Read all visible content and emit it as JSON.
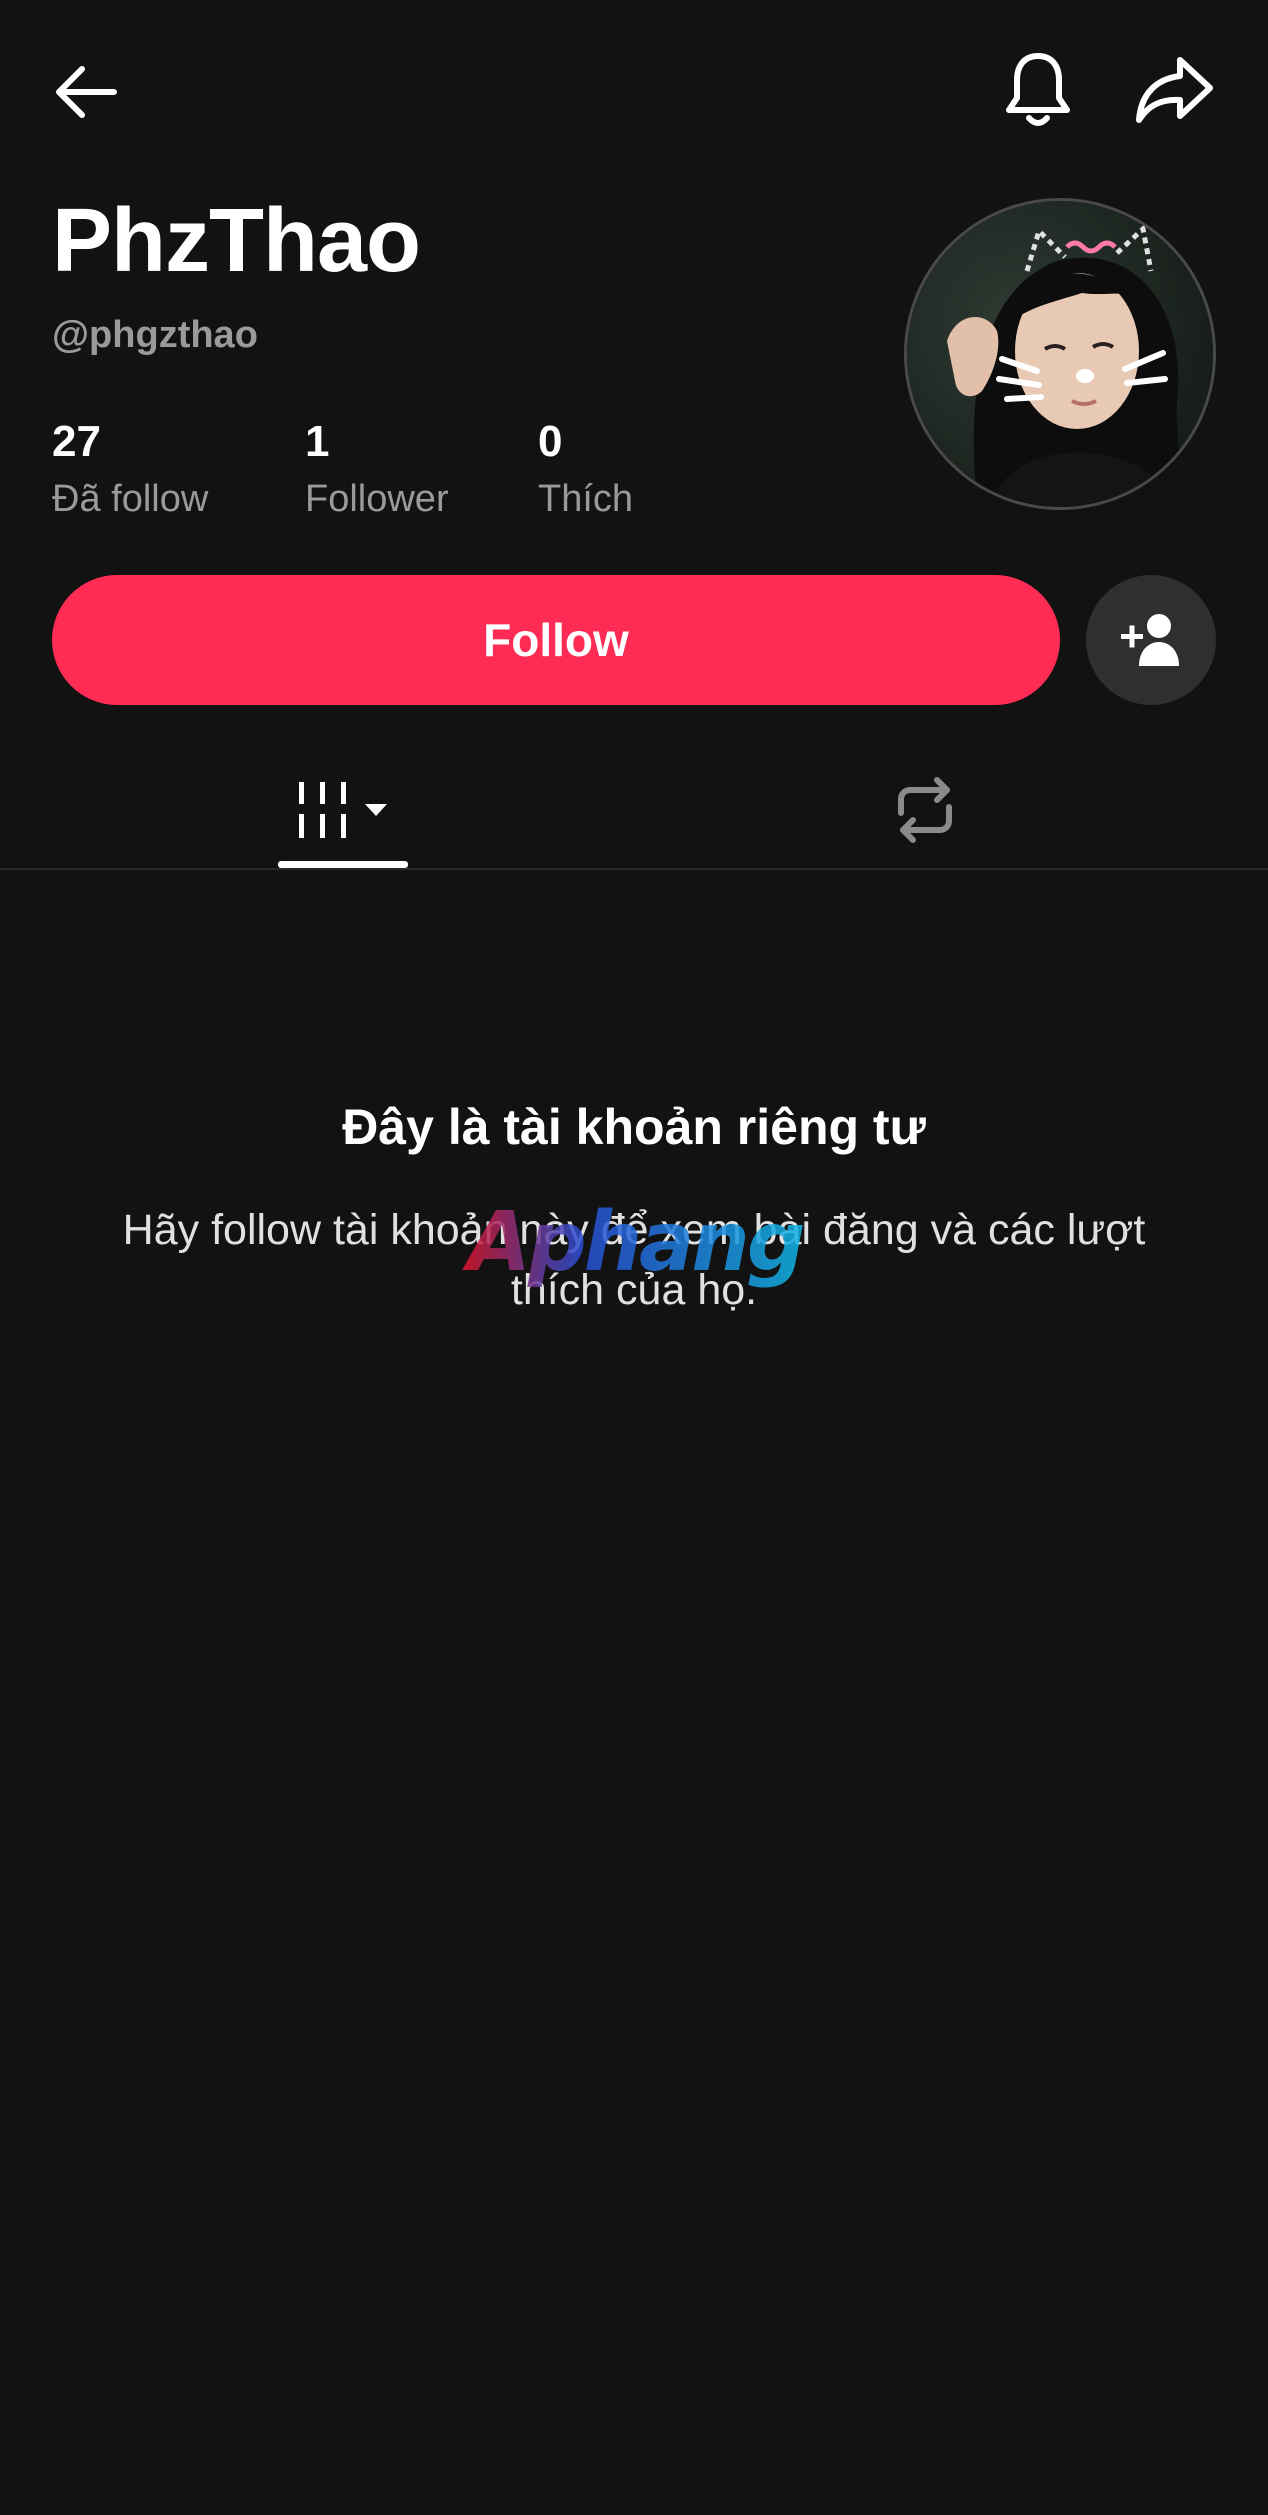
{
  "header": {
    "display_name": "PhzThao",
    "username": "@phgzthao"
  },
  "stats": [
    {
      "value": "27",
      "label": "Đã follow"
    },
    {
      "value": "1",
      "label": "Follower"
    },
    {
      "value": "0",
      "label": "Thích"
    }
  ],
  "actions": {
    "follow_label": "Follow"
  },
  "tabs": {
    "active": "videos"
  },
  "private_notice": {
    "title": "Đây là tài khoản riêng tư",
    "description": "Hãy follow tài khoản này để xem bài đăng và các lượt thích của họ."
  },
  "watermark": {
    "text": "Aphang"
  },
  "colors": {
    "background": "#121212",
    "accent": "#fe2c55",
    "secondary_text": "#9a9a9a",
    "icon_button_bg": "#2f2f2f"
  },
  "icons": [
    "back-arrow-icon",
    "bell-icon",
    "share-icon",
    "add-friend-icon",
    "video-grid-icon",
    "dropdown-caret-icon",
    "repost-icon"
  ]
}
